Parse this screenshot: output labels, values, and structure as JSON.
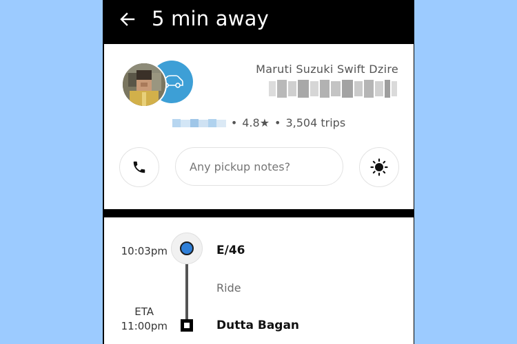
{
  "header": {
    "title": "5 min away"
  },
  "driver": {
    "vehicle_name": "Maruti Suzuki Swift Dzire",
    "rating": "4.8★",
    "trips": "3,504 trips",
    "separator": "•"
  },
  "actions": {
    "notes_placeholder": "Any pickup notes?"
  },
  "trip": {
    "pickup_time": "10:03pm",
    "pickup_name": "E/46",
    "ride_label": "Ride",
    "eta_label": "ETA",
    "dropoff_time": "11:00pm",
    "dropoff_name": "Dutta Bagan"
  },
  "colors": {
    "background": "#9ccbff",
    "header": "#000000",
    "car_badge": "#3d9fd6",
    "pickup_dot": "#2f7fd8"
  },
  "icons": [
    "back-arrow-icon",
    "car-icon",
    "phone-icon",
    "brightness-icon"
  ]
}
